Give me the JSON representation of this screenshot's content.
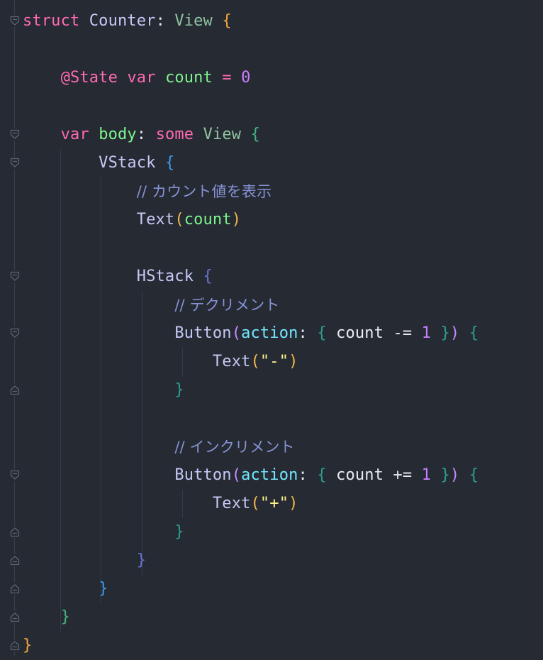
{
  "colors": {
    "background": "#262a33",
    "keyword": "#ff6ab3",
    "type": "#c5c9f5",
    "view_type": "#8fc4a0",
    "brace_outer": "#f5a63d",
    "brace_green": "#43b580",
    "brace_blue": "#3d9be9",
    "brace_indigo": "#6674d4",
    "brace_teal": "#2c9e8e",
    "property": "#7ef48d",
    "number": "#c97fff",
    "comment": "#8692d4",
    "plain": "#e8ebf2",
    "param": "#73e8ff",
    "string": "#fff38a",
    "paren_orange": "#f2b94a",
    "paren_violet": "#c78bff"
  },
  "gutter": {
    "fold_icons": [
      "fold-open-icon",
      "fold-close-icon"
    ]
  },
  "code": {
    "lines": [
      {
        "tokens": [
          {
            "t": "struct",
            "c": "keyword"
          },
          {
            "t": " ",
            "c": "plain"
          },
          {
            "t": "Counter",
            "c": "type"
          },
          {
            "t": ": ",
            "c": "plain"
          },
          {
            "t": "View",
            "c": "view_type"
          },
          {
            "t": " ",
            "c": "plain"
          },
          {
            "t": "{",
            "c": "brace_outer"
          }
        ]
      },
      {
        "tokens": []
      },
      {
        "tokens": [
          {
            "t": "    ",
            "c": "plain"
          },
          {
            "t": "@State",
            "c": "keyword"
          },
          {
            "t": " ",
            "c": "plain"
          },
          {
            "t": "var",
            "c": "keyword"
          },
          {
            "t": " ",
            "c": "plain"
          },
          {
            "t": "count",
            "c": "property"
          },
          {
            "t": " = ",
            "c": "keyword"
          },
          {
            "t": "0",
            "c": "number"
          }
        ]
      },
      {
        "tokens": []
      },
      {
        "tokens": [
          {
            "t": "    ",
            "c": "plain"
          },
          {
            "t": "var",
            "c": "keyword"
          },
          {
            "t": " ",
            "c": "plain"
          },
          {
            "t": "body",
            "c": "property"
          },
          {
            "t": ": ",
            "c": "plain"
          },
          {
            "t": "some",
            "c": "keyword"
          },
          {
            "t": " ",
            "c": "plain"
          },
          {
            "t": "View",
            "c": "view_type"
          },
          {
            "t": " ",
            "c": "plain"
          },
          {
            "t": "{",
            "c": "brace_green"
          }
        ]
      },
      {
        "tokens": [
          {
            "t": "        ",
            "c": "plain"
          },
          {
            "t": "VStack",
            "c": "type"
          },
          {
            "t": " ",
            "c": "plain"
          },
          {
            "t": "{",
            "c": "brace_blue"
          }
        ]
      },
      {
        "tokens": [
          {
            "t": "            ",
            "c": "plain"
          },
          {
            "t": "// カウント値を表示",
            "c": "comment"
          }
        ]
      },
      {
        "tokens": [
          {
            "t": "            ",
            "c": "plain"
          },
          {
            "t": "Text",
            "c": "type"
          },
          {
            "t": "(",
            "c": "paren_orange"
          },
          {
            "t": "count",
            "c": "property"
          },
          {
            "t": ")",
            "c": "paren_orange"
          }
        ]
      },
      {
        "tokens": []
      },
      {
        "tokens": [
          {
            "t": "            ",
            "c": "plain"
          },
          {
            "t": "HStack",
            "c": "type"
          },
          {
            "t": " ",
            "c": "plain"
          },
          {
            "t": "{",
            "c": "brace_indigo"
          }
        ]
      },
      {
        "tokens": [
          {
            "t": "                ",
            "c": "plain"
          },
          {
            "t": "// デクリメント",
            "c": "comment"
          }
        ]
      },
      {
        "tokens": [
          {
            "t": "                ",
            "c": "plain"
          },
          {
            "t": "Button",
            "c": "type"
          },
          {
            "t": "(",
            "c": "paren_violet"
          },
          {
            "t": "action",
            "c": "param"
          },
          {
            "t": ": ",
            "c": "plain"
          },
          {
            "t": "{",
            "c": "brace_teal"
          },
          {
            "t": " count ",
            "c": "plain"
          },
          {
            "t": "-=",
            "c": "plain"
          },
          {
            "t": " ",
            "c": "plain"
          },
          {
            "t": "1",
            "c": "number"
          },
          {
            "t": " ",
            "c": "plain"
          },
          {
            "t": "}",
            "c": "brace_teal"
          },
          {
            "t": ")",
            "c": "paren_violet"
          },
          {
            "t": " ",
            "c": "plain"
          },
          {
            "t": "{",
            "c": "brace_teal"
          }
        ]
      },
      {
        "tokens": [
          {
            "t": "                    ",
            "c": "plain"
          },
          {
            "t": "Text",
            "c": "type"
          },
          {
            "t": "(",
            "c": "paren_orange"
          },
          {
            "t": "\"-\"",
            "c": "string"
          },
          {
            "t": ")",
            "c": "paren_orange"
          }
        ]
      },
      {
        "tokens": [
          {
            "t": "                ",
            "c": "plain"
          },
          {
            "t": "}",
            "c": "brace_teal"
          }
        ]
      },
      {
        "tokens": []
      },
      {
        "tokens": [
          {
            "t": "                ",
            "c": "plain"
          },
          {
            "t": "// インクリメント",
            "c": "comment"
          }
        ]
      },
      {
        "tokens": [
          {
            "t": "                ",
            "c": "plain"
          },
          {
            "t": "Button",
            "c": "type"
          },
          {
            "t": "(",
            "c": "paren_violet"
          },
          {
            "t": "action",
            "c": "param"
          },
          {
            "t": ": ",
            "c": "plain"
          },
          {
            "t": "{",
            "c": "brace_teal"
          },
          {
            "t": " count ",
            "c": "plain"
          },
          {
            "t": "+=",
            "c": "plain"
          },
          {
            "t": " ",
            "c": "plain"
          },
          {
            "t": "1",
            "c": "number"
          },
          {
            "t": " ",
            "c": "plain"
          },
          {
            "t": "}",
            "c": "brace_teal"
          },
          {
            "t": ")",
            "c": "paren_violet"
          },
          {
            "t": " ",
            "c": "plain"
          },
          {
            "t": "{",
            "c": "brace_teal"
          }
        ]
      },
      {
        "tokens": [
          {
            "t": "                    ",
            "c": "plain"
          },
          {
            "t": "Text",
            "c": "type"
          },
          {
            "t": "(",
            "c": "paren_orange"
          },
          {
            "t": "\"+\"",
            "c": "string"
          },
          {
            "t": ")",
            "c": "paren_orange"
          }
        ]
      },
      {
        "tokens": [
          {
            "t": "                ",
            "c": "plain"
          },
          {
            "t": "}",
            "c": "brace_teal"
          }
        ]
      },
      {
        "tokens": [
          {
            "t": "            ",
            "c": "plain"
          },
          {
            "t": "}",
            "c": "brace_indigo"
          }
        ]
      },
      {
        "tokens": [
          {
            "t": "        ",
            "c": "plain"
          },
          {
            "t": "}",
            "c": "brace_blue"
          }
        ]
      },
      {
        "tokens": [
          {
            "t": "    ",
            "c": "plain"
          },
          {
            "t": "}",
            "c": "brace_green"
          }
        ]
      },
      {
        "tokens": [
          {
            "t": "}",
            "c": "brace_outer"
          }
        ]
      }
    ]
  }
}
